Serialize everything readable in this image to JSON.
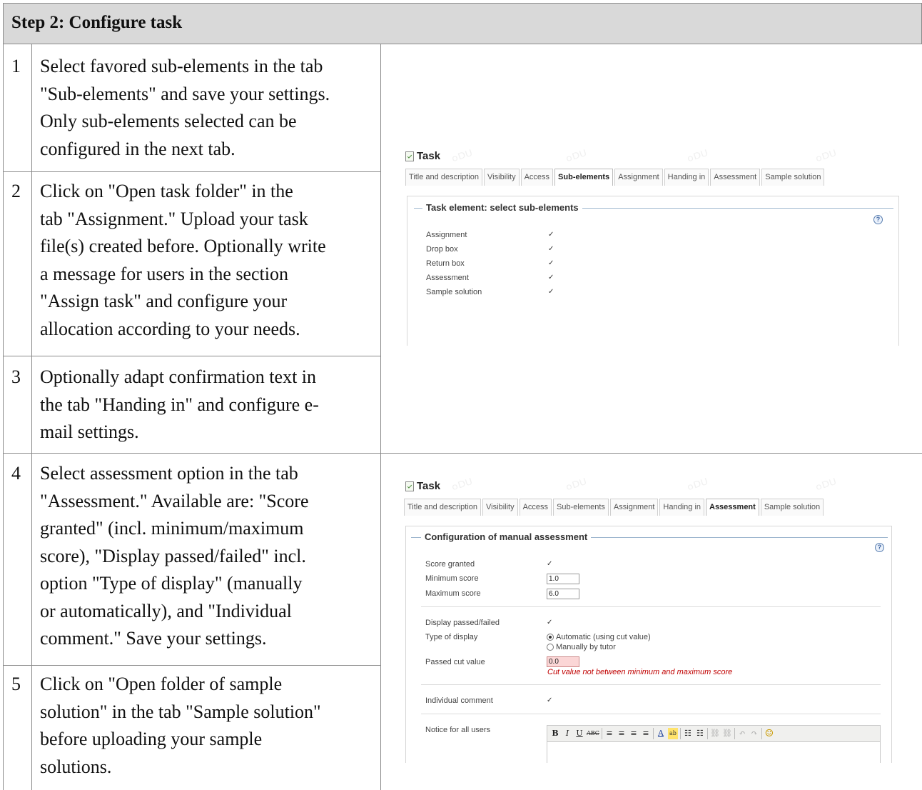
{
  "header": {
    "title": "Step 2: Configure task"
  },
  "steps": [
    {
      "num": "1",
      "lines": [
        "Select favored sub-elements in the tab",
        "\"Sub-elements\" and save your settings.",
        "Only sub-elements selected can be",
        "configured in the next tab."
      ]
    },
    {
      "num": "2",
      "lines": [
        "Click on \"Open task folder\" in the",
        "tab \"Assignment.\" Upload your task",
        "file(s) created before. Optionally write",
        "a message for users in the section",
        "\"Assign task\" and configure your",
        "allocation according to your needs."
      ]
    },
    {
      "num": "3",
      "lines": [
        "Optionally adapt confirmation text in",
        "the tab \"Handing in\" and configure e-",
        "mail settings."
      ]
    },
    {
      "num": "4",
      "lines": [
        "Select assessment option in the tab",
        "\"Assessment.\" Available are: \"Score",
        "granted\" (incl. minimum/maximum",
        "score), \"Display passed/failed\" incl.",
        "option \"Type of display\" (manually",
        "or automatically), and \"Individual",
        "comment.\" Save your settings."
      ]
    },
    {
      "num": "5",
      "lines": [
        "Click on \"Open folder of sample",
        "solution\" in the tab \"Sample solution\"",
        "before uploading your sample",
        "solutions."
      ]
    }
  ],
  "shot1": {
    "title": "Task",
    "tabs": [
      "Title and description",
      "Visibility",
      "Access",
      "Sub-elements",
      "Assignment",
      "Handing in",
      "Assessment",
      "Sample solution"
    ],
    "active_tab": "Sub-elements",
    "legend": "Task element: select sub-elements",
    "help": "?",
    "rows": [
      {
        "label": "Assignment",
        "checked": "✓"
      },
      {
        "label": "Drop box",
        "checked": "✓"
      },
      {
        "label": "Return box",
        "checked": "✓"
      },
      {
        "label": "Assessment",
        "checked": "✓"
      },
      {
        "label": "Sample solution",
        "checked": "✓"
      }
    ]
  },
  "shot2": {
    "title": "Task",
    "tabs": [
      "Title and description",
      "Visibility",
      "Access",
      "Sub-elements",
      "Assignment",
      "Handing in",
      "Assessment",
      "Sample solution"
    ],
    "active_tab": "Assessment",
    "legend": "Configuration of manual assessment",
    "help": "?",
    "score_granted": {
      "label": "Score granted",
      "checked": "✓"
    },
    "min_score": {
      "label": "Minimum score",
      "value": "1.0"
    },
    "max_score": {
      "label": "Maximum score",
      "value": "6.0"
    },
    "display_passed": {
      "label": "Display passed/failed",
      "checked": "✓"
    },
    "type_display": {
      "label": "Type of display",
      "option_auto": "Automatic (using cut value)",
      "option_manual": "Manually by tutor"
    },
    "cut_value": {
      "label": "Passed cut value",
      "value": "0.0",
      "error": "Cut value not between minimum and maximum score"
    },
    "individual_comment": {
      "label": "Individual comment",
      "checked": "✓"
    },
    "notice": {
      "label": "Notice for all users"
    },
    "toolbar": [
      "B",
      "I",
      "U",
      "ABC",
      "≡",
      "≡",
      "≡",
      "≡",
      "A",
      "ab",
      "☷",
      "☷",
      "⛓",
      "⛓",
      "↶",
      "↷",
      "☺"
    ]
  }
}
